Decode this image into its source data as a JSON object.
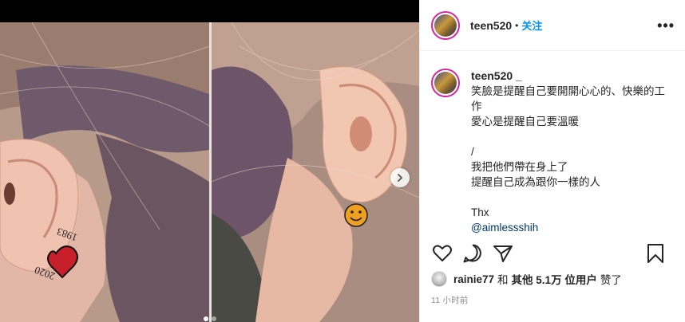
{
  "post": {
    "username": "teen520",
    "separator": "•",
    "follow_label": "关注",
    "more_label": "•••"
  },
  "caption": {
    "username": "teen520 _",
    "lines": [
      "笑臉是提醒自己要開開心心的、快樂的工作",
      "愛心是提醒自己要溫暖",
      "",
      "/",
      "我把他們帶在身上了",
      "提醒自己成為跟你一樣的人",
      "",
      "Thx",
      "@aimlessshih"
    ]
  },
  "likes": {
    "user": "rainie77",
    "connector": "和",
    "others": "其他 5.1万 位用户",
    "suffix": "赞了"
  },
  "timestamp": "11 小时前",
  "carousel": {
    "slides": 2,
    "active_index": 0
  },
  "photo": {
    "left_tattoo_text_1": "1983",
    "left_tattoo_text_2": "2020"
  },
  "colors": {
    "accent": "#0095f6",
    "mention": "#00376b",
    "muted": "#8e8e8e"
  },
  "icons": [
    "heart-icon",
    "comment-icon",
    "share-icon",
    "bookmark-icon",
    "chevron-right-icon",
    "more-icon"
  ]
}
